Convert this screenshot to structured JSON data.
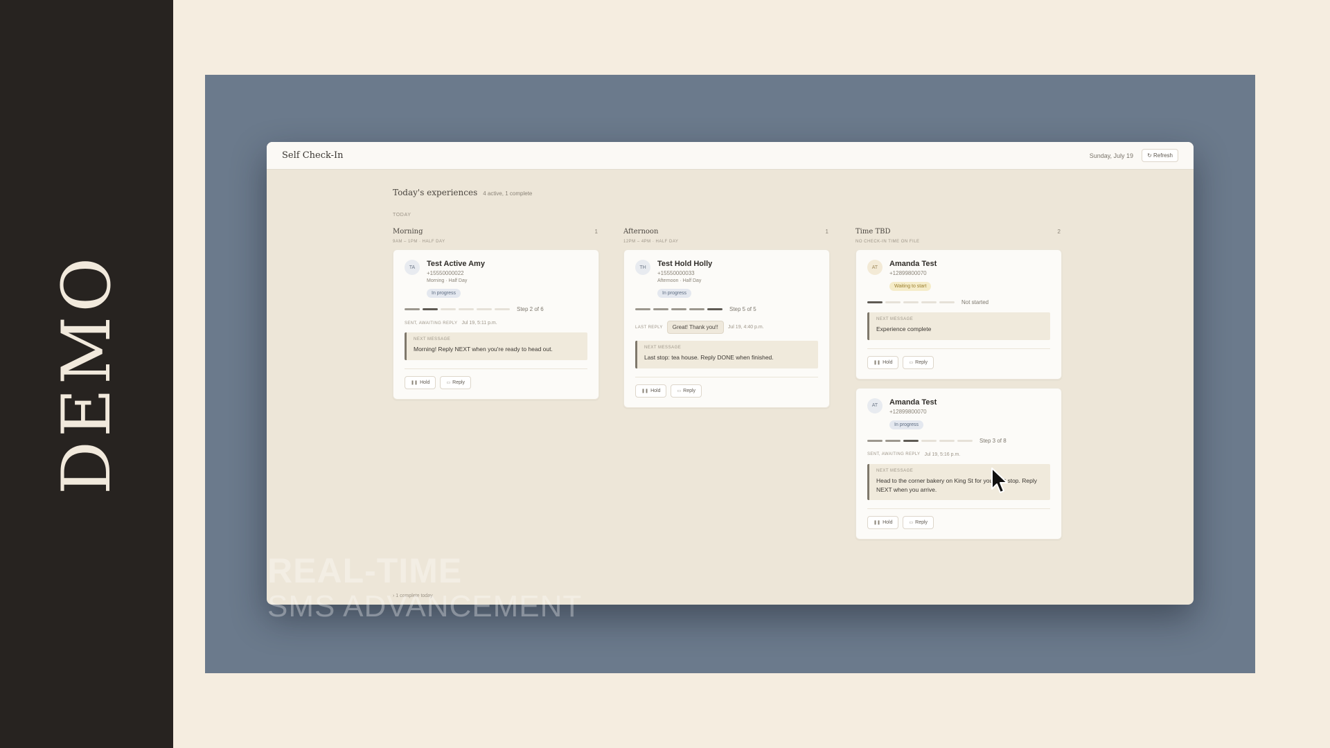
{
  "slide": {
    "side_label": "DEMO"
  },
  "app": {
    "title": "Self Check-In",
    "date": "Sunday, July 19",
    "refresh_label": "↻ Refresh",
    "section_title": "Today's experiences",
    "section_summary": "4 active, 1 complete",
    "today_label": "TODAY",
    "complete_note": "› 1 complete today"
  },
  "columns": [
    {
      "name": "Morning",
      "count": "1",
      "subtitle": "9AM – 1PM · HALF DAY",
      "cards": [
        {
          "initials": "TA",
          "name": "Test Active Amy",
          "phone": "+15550000022",
          "slot": "Morning · Half Day",
          "status": "In progress",
          "step_text": "Step 2 of 6",
          "meta_label": "SENT, AWAITING REPLY",
          "meta_time": "Jul 19, 5:11 p.m.",
          "next_label": "NEXT MESSAGE",
          "next_text": "Morning! Reply NEXT when you're ready to head out.",
          "hold_label": "Hold",
          "reply_label": "Reply"
        }
      ]
    },
    {
      "name": "Afternoon",
      "count": "1",
      "subtitle": "12PM – 4PM · HALF DAY",
      "cards": [
        {
          "initials": "TH",
          "name": "Test Hold Holly",
          "phone": "+15550000033",
          "slot": "Afternoon · Half Day",
          "status": "In progress",
          "step_text": "Step 5 of 5",
          "meta_label": "LAST REPLY",
          "reply_chip": "Great! Thank you!!",
          "meta_time": "Jul 19, 4:40 p.m.",
          "next_label": "NEXT MESSAGE",
          "next_text": "Last stop: tea house. Reply DONE when finished.",
          "hold_label": "Hold",
          "reply_label": "Reply"
        }
      ]
    },
    {
      "name": "Time TBD",
      "count": "2",
      "subtitle": "NO CHECK-IN TIME ON FILE",
      "cards": [
        {
          "initials": "AT",
          "name": "Amanda Test",
          "phone": "+12899800070",
          "status": "Waiting to start",
          "step_text": "Not started",
          "next_label": "NEXT MESSAGE",
          "next_text": "Experience complete",
          "hold_label": "Hold",
          "reply_label": "Reply"
        },
        {
          "initials": "AT",
          "name": "Amanda Test",
          "phone": "+12899800070",
          "status": "In progress",
          "step_text": "Step 3 of 8",
          "meta_label": "SENT, AWAITING REPLY",
          "meta_time": "Jul 19, 5:16 p.m.",
          "next_label": "NEXT MESSAGE",
          "next_text": "Head to the corner bakery on King St for your first stop. Reply NEXT when you arrive.",
          "hold_label": "Hold",
          "reply_label": "Reply"
        }
      ]
    }
  ],
  "overlay": {
    "line1": "REAL-TIME",
    "line2": "SMS ADVANCEMENT"
  },
  "colors": {
    "background": "#f5ede0",
    "side_band": "#272320",
    "stage": "#6b7a8c",
    "app_bg": "#ede6d8",
    "progress_badge": "#e4e8ef",
    "waiting_badge": "#f5ecc9"
  },
  "icons": {
    "hold": "pause-icon",
    "reply": "chat-bubble-icon",
    "refresh": "refresh-icon",
    "cursor": "mouse-pointer-icon"
  }
}
